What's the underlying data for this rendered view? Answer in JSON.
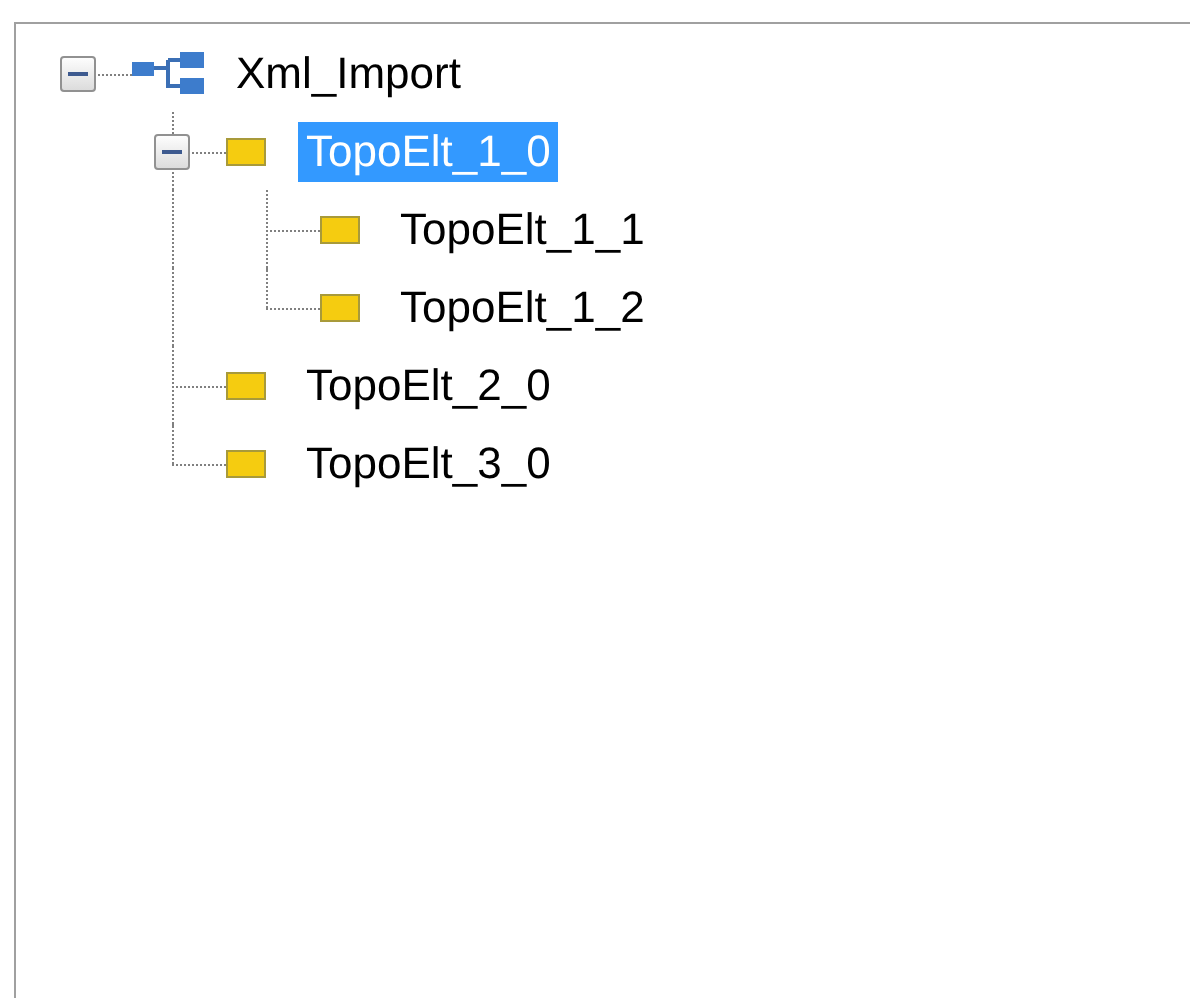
{
  "tree": [
    {
      "label": "Xml_Import",
      "kind": "root",
      "expanded": true,
      "selected": false,
      "children": [
        {
          "label": "TopoElt_1_0",
          "kind": "element",
          "expanded": true,
          "selected": true,
          "children": [
            {
              "label": "TopoElt_1_1",
              "kind": "element",
              "selected": false
            },
            {
              "label": "TopoElt_1_2",
              "kind": "element",
              "selected": false
            }
          ]
        },
        {
          "label": "TopoElt_2_0",
          "kind": "element",
          "selected": false
        },
        {
          "label": "TopoElt_3_0",
          "kind": "element",
          "selected": false
        }
      ]
    }
  ]
}
